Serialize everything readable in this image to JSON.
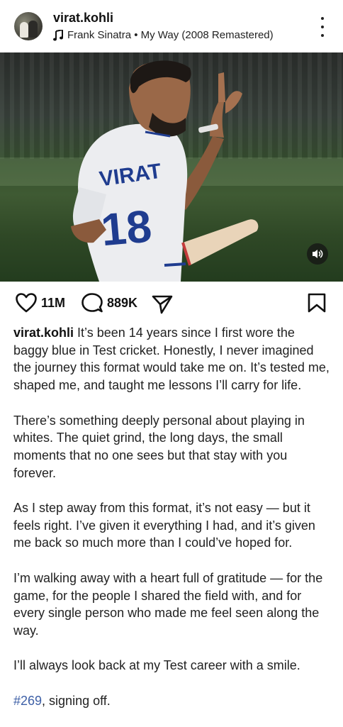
{
  "post": {
    "username": "virat.kohli",
    "audio": "Frank Sinatra • My Way (2008 Remastered)",
    "photo_text": {
      "jersey_name": "VIRAT",
      "jersey_number": "18"
    }
  },
  "actions": {
    "likes": "11M",
    "comments": "889K"
  },
  "caption": {
    "username": "virat.kohli",
    "p1": "It’s been 14 years since I first wore the baggy blue in Test cricket. Honestly, I never imagined the journey this format would take me on. It’s tested me, shaped me, and taught me lessons I’ll carry for life.",
    "p2": "There’s something deeply personal about playing in whites. The quiet grind, the long days, the small moments that no one sees but that stay with you forever.",
    "p3": "As I step away from this format, it’s not easy — but it feels right. I’ve given it everything I had, and it’s given me back so much more than I could’ve hoped for.",
    "p4": "I’m walking away with a heart full of gratitude — for the game, for the people I shared the field with, and for every single person who made me feel seen along the way.",
    "p5": "I’ll always look back at my Test career with a smile.",
    "hashtag": "#269",
    "signoff": ", signing off."
  }
}
